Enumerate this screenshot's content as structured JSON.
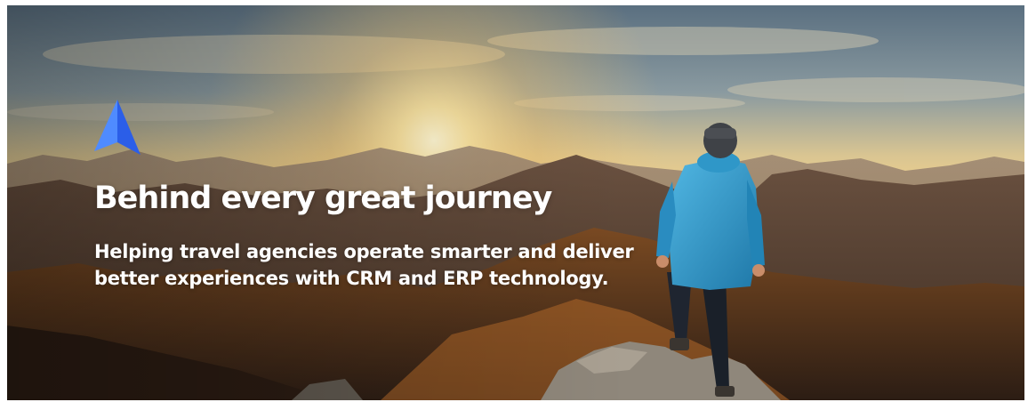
{
  "hero": {
    "headline": "Behind every great journey",
    "subline_1": "Helping travel agencies operate smarter and deliver",
    "subline_2": "better experiences with CRM and ERP technology."
  },
  "logo": {
    "icon": "arrow-up-logo-icon",
    "color_light": "#4f8bff",
    "color_dark": "#2b5ee8"
  },
  "photo": {
    "subject": "hiker-in-blue-jacket-icon",
    "jacket_color": "#2f97c8",
    "sun_color": "#ffe9a8"
  }
}
